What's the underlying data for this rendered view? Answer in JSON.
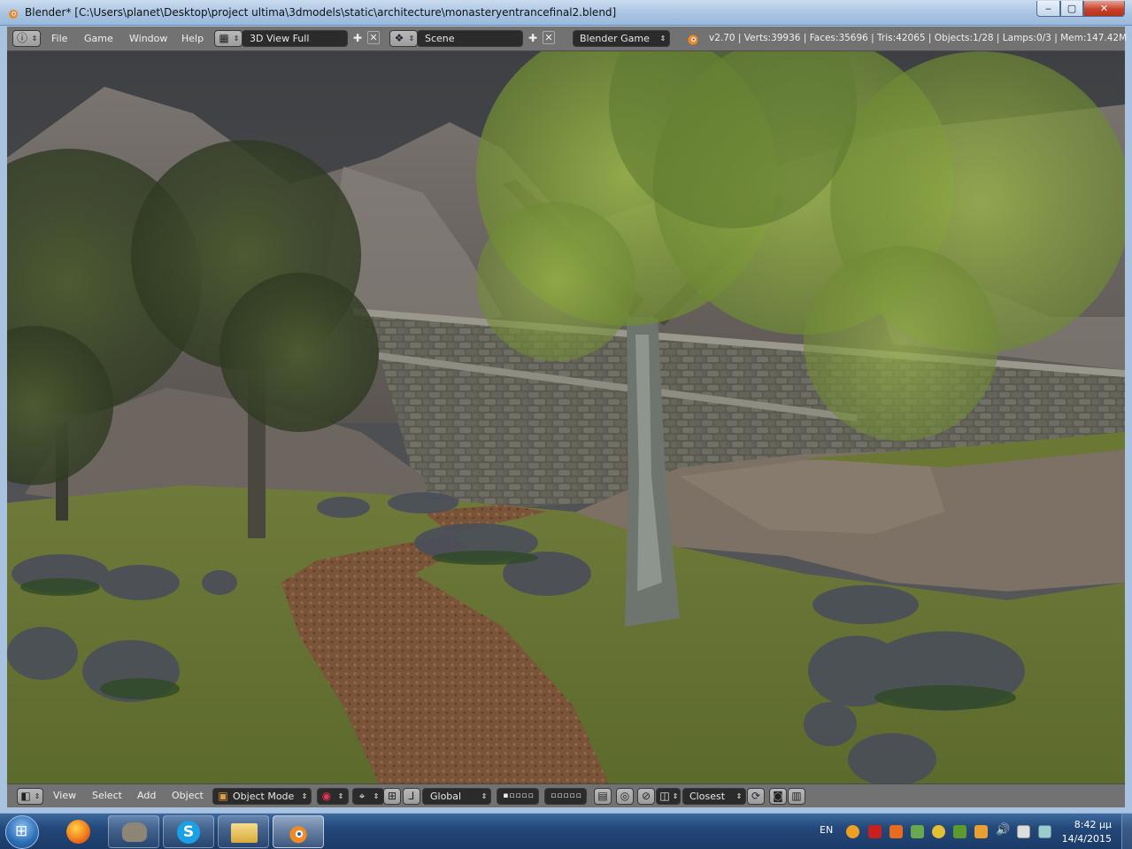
{
  "window": {
    "title": "Blender* [C:\\Users\\planet\\Desktop\\project ultima\\3dmodels\\static\\architecture\\monasteryentrancefinal2.blend]",
    "minimize_glyph": "‒",
    "maximize_glyph": "▢",
    "close_glyph": "✕"
  },
  "info_header": {
    "menus": [
      "File",
      "Game",
      "Window",
      "Help"
    ],
    "screen_layout": "3D View Full",
    "scene": "Scene",
    "engine": "Blender Game",
    "stats": "v2.70 | Verts:39936 | Faces:35696 | Tris:42065 | Objects:1/28 | Lamps:0/3 | Mem:147.42M"
  },
  "view_header": {
    "menus": [
      "View",
      "Select",
      "Add",
      "Object"
    ],
    "mode": "Object Mode",
    "orientation": "Global",
    "snap_target": "Closest"
  },
  "taskbar": {
    "language": "EN",
    "time": "8:42 μμ",
    "date": "14/4/2015",
    "apps": [
      "start-orb-icon",
      "firefox-icon",
      "gimp-icon",
      "skype-icon",
      "file-explorer-icon",
      "blender-icon"
    ]
  },
  "colors": {
    "blender_header": "#727272",
    "blender_field": "#2b2b2b",
    "taskbar": "#24487a",
    "titlebar": "#a9c4e2"
  }
}
